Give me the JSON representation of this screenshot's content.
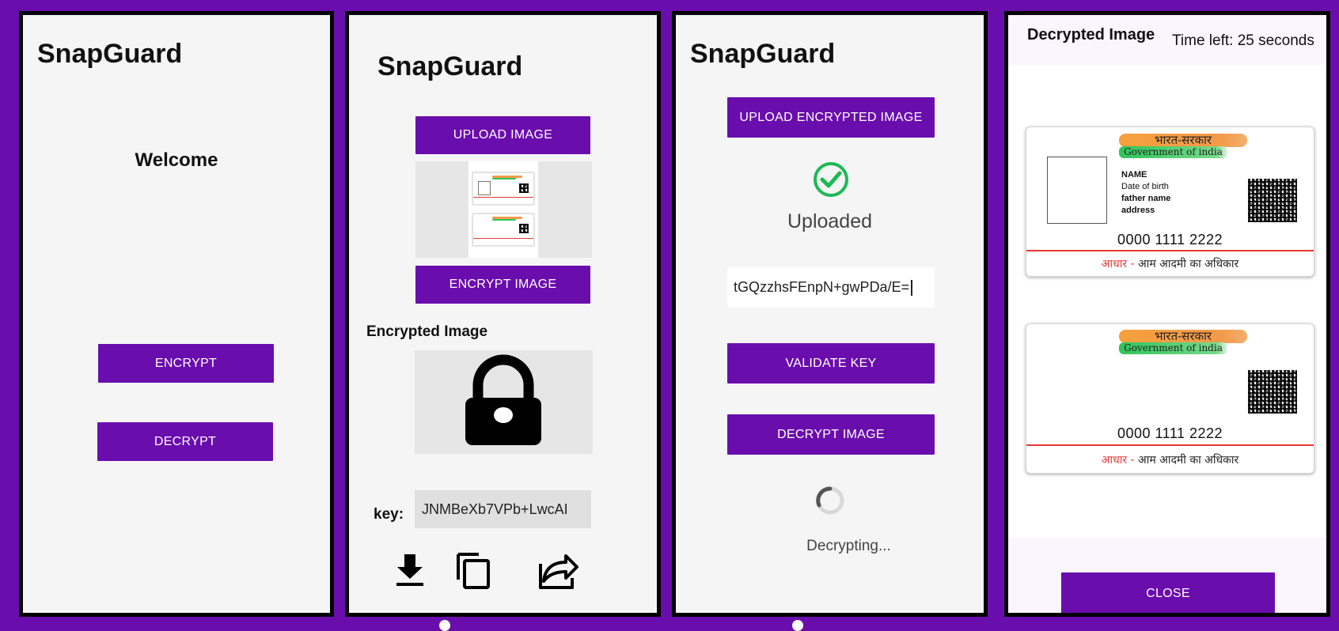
{
  "screen1": {
    "title": "SnapGuard",
    "welcome": "Welcome",
    "encrypt_label": "ENCRYPT",
    "decrypt_label": "DECRYPT"
  },
  "screen2": {
    "title": "SnapGuard",
    "upload_label": "UPLOAD IMAGE",
    "encrypt_image_label": "ENCRYPT IMAGE",
    "encrypted_heading": "Encrypted Image",
    "key_label": "key:",
    "key_value": "JNMBeXb7VPb+LwcAI",
    "icons": [
      "download-icon",
      "copy-icon",
      "share-icon"
    ]
  },
  "screen3": {
    "title": "SnapGuard",
    "upload_encrypted_label": "UPLOAD ENCRYPTED IMAGE",
    "status": "Uploaded",
    "key_input_value": "tGQzzhsFEnpN+gwPDa/E=",
    "validate_label": "VALIDATE KEY",
    "decrypt_image_label": "DECRYPT IMAGE",
    "progress_text": "Decrypting..."
  },
  "screen4": {
    "title": "Decrypted Image",
    "timer": "Time left: 25 seconds",
    "close_label": "CLOSE",
    "card": {
      "gov_hindi": "भारत-सरकार",
      "gov_english": "Government of india",
      "fields": [
        "NAME",
        "Date of birth",
        "father name",
        "address"
      ],
      "number": "0000  1111 2222",
      "footer_red": "आधार -",
      "footer_rest": " आम आदमी का अधिकार"
    }
  },
  "colors": {
    "brand_purple": "#6a0dad",
    "success_green": "#1db954",
    "accent_red": "#e53935"
  }
}
